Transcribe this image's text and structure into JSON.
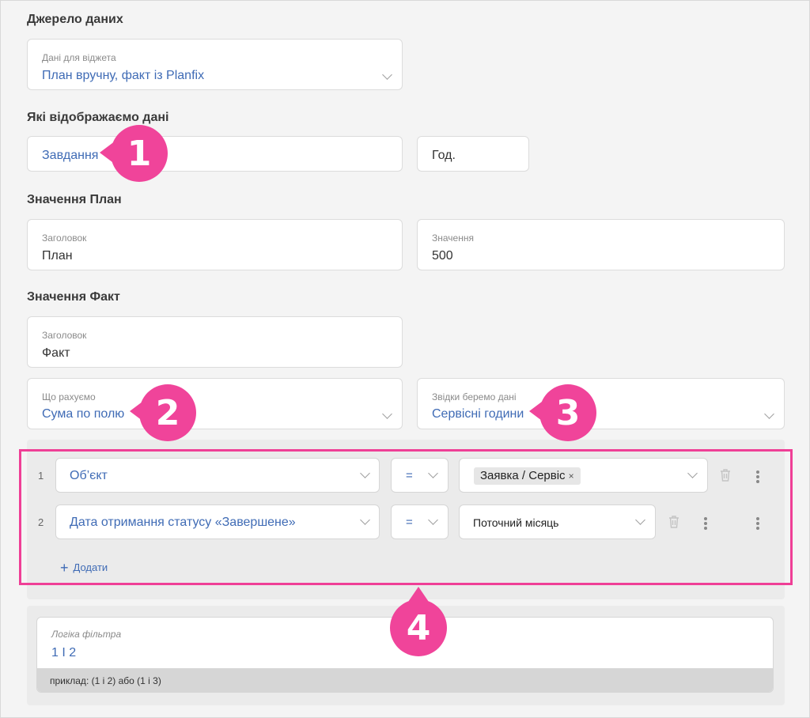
{
  "sections": {
    "source": "Джерело даних",
    "display": "Які відображаємо дані",
    "plan": "Значення План",
    "fact": "Значення Факт"
  },
  "widget_data": {
    "label": "Дані для віджета",
    "value": "План вручну, факт із Planfix"
  },
  "display_entity": "Завдання",
  "display_unit": "Год.",
  "plan_title": {
    "label": "Заголовок",
    "value": "План"
  },
  "plan_value": {
    "label": "Значення",
    "value": "500"
  },
  "fact_title": {
    "label": "Заголовок",
    "value": "Факт"
  },
  "count_what": {
    "label": "Що рахуємо",
    "value": "Сума по полю"
  },
  "data_from": {
    "label": "Звідки беремо дані",
    "value": "Сервісні години"
  },
  "filters": [
    {
      "num": "1",
      "field": "Об’єкт",
      "op": "=",
      "value": "Заявка / Сервіс",
      "remove": "×"
    },
    {
      "num": "2",
      "field": "Дата отримання статусу «Завершене»",
      "op": "=",
      "value": "Поточний місяць"
    }
  ],
  "add_label": "Додати",
  "add_icon": "+",
  "filter_logic": {
    "label": "Логіка фільтра",
    "value": "1 І 2",
    "hint": "приклад: (1 і 2) або (1 і 3)"
  },
  "badges": [
    "1",
    "2",
    "3",
    "4"
  ],
  "colors": {
    "accent": "#f0449a",
    "link": "#3f6bb5"
  }
}
